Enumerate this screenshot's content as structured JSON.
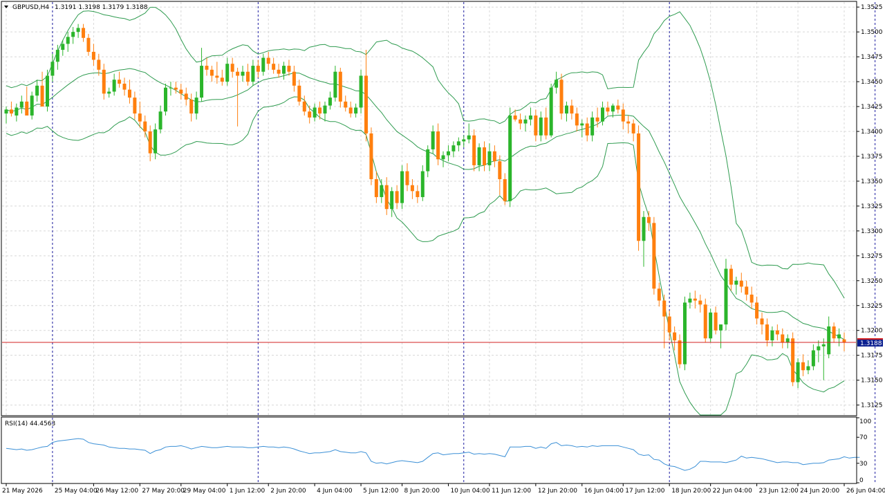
{
  "header": {
    "symbol_label": "GBPUSD,H4",
    "ohlc_label": "1.3191 1.3198 1.3179 1.3188"
  },
  "indicator": {
    "label": "RSI(14) 44.4563"
  },
  "colors": {
    "bull": "#2bb52b",
    "bear": "#ff7f0e",
    "band": "#2e9b4f",
    "rsi": "#3a8fd6",
    "bid_line": "#d32020",
    "bid_box": "#0b1f8f"
  },
  "chart_data": [
    {
      "type": "candlestick",
      "title": "GBPUSD,H4",
      "ylim": [
        1.3115,
        1.353
      ],
      "y_ticks": [
        "1.3525",
        "1.3500",
        "1.3475",
        "1.3450",
        "1.3425",
        "1.3400",
        "1.3375",
        "1.3350",
        "1.3325",
        "1.3300",
        "1.3275",
        "1.3250",
        "1.3225",
        "1.3200",
        "1.3175",
        "1.3150",
        "1.3125"
      ],
      "x_labels": [
        "21 May 2026",
        "25 May 04:00",
        "26 May 12:00",
        "27 May 20:00",
        "29 May 04:00",
        "1 Jun 12:00",
        "2 Jun 20:00",
        "4 Jun 04:00",
        "5 Jun 12:00",
        "8 Jun 20:00",
        "10 Jun 04:00",
        "11 Jun 12:00",
        "12 Jun 20:00",
        "16 Jun 04:00",
        "17 Jun 12:00",
        "18 Jun 20:00",
        "22 Jun 04:00",
        "23 Jun 12:00",
        "24 Jun 20:00",
        "26 Jun 04:00"
      ],
      "current_price": 1.3188,
      "current_price_label": "1.3188",
      "grid": true,
      "candles": [
        [
          1.3418,
          1.3425,
          1.3408,
          1.3422
        ],
        [
          1.3422,
          1.343,
          1.3415,
          1.3418
        ],
        [
          1.3416,
          1.3428,
          1.341,
          1.3424
        ],
        [
          1.3424,
          1.3436,
          1.3418,
          1.343
        ],
        [
          1.343,
          1.3445,
          1.342,
          1.3416
        ],
        [
          1.3416,
          1.344,
          1.3412,
          1.3436
        ],
        [
          1.3436,
          1.3452,
          1.343,
          1.3446
        ],
        [
          1.3446,
          1.346,
          1.3438,
          1.3425
        ],
        [
          1.3425,
          1.3462,
          1.342,
          1.3456
        ],
        [
          1.3456,
          1.3478,
          1.345,
          1.347
        ],
        [
          1.347,
          1.3487,
          1.3462,
          1.3482
        ],
        [
          1.3482,
          1.3492,
          1.3476,
          1.3488
        ],
        [
          1.3488,
          1.35,
          1.348,
          1.3495
        ],
        [
          1.3495,
          1.3505,
          1.3488,
          1.35
        ],
        [
          1.35,
          1.3508,
          1.3494,
          1.3504
        ],
        [
          1.3504,
          1.3508,
          1.349,
          1.3494
        ],
        [
          1.3494,
          1.3498,
          1.3476,
          1.348
        ],
        [
          1.348,
          1.3488,
          1.3466,
          1.3472
        ],
        [
          1.3472,
          1.3478,
          1.3456,
          1.3462
        ],
        [
          1.3462,
          1.3468,
          1.3432,
          1.3438
        ],
        [
          1.3438,
          1.3444,
          1.3434,
          1.344
        ],
        [
          1.344,
          1.3458,
          1.3436,
          1.3452
        ],
        [
          1.3452,
          1.346,
          1.3444,
          1.3448
        ],
        [
          1.3448,
          1.3454,
          1.3436,
          1.3442
        ],
        [
          1.3442,
          1.3452,
          1.3428,
          1.3434
        ],
        [
          1.3434,
          1.344,
          1.3412,
          1.3418
        ],
        [
          1.3418,
          1.343,
          1.3404,
          1.341
        ],
        [
          1.341,
          1.3416,
          1.3394,
          1.34
        ],
        [
          1.34,
          1.3406,
          1.337,
          1.3378
        ],
        [
          1.3378,
          1.3408,
          1.3372,
          1.3402
        ],
        [
          1.3402,
          1.3426,
          1.3398,
          1.342
        ],
        [
          1.342,
          1.3448,
          1.3416,
          1.3444
        ],
        [
          1.3444,
          1.345,
          1.3436,
          1.3444
        ],
        [
          1.3444,
          1.345,
          1.3438,
          1.3442
        ],
        [
          1.3442,
          1.3448,
          1.3432,
          1.3438
        ],
        [
          1.3438,
          1.3444,
          1.3426,
          1.3432
        ],
        [
          1.3432,
          1.3438,
          1.341,
          1.3418
        ],
        [
          1.3418,
          1.344,
          1.3412,
          1.3434
        ],
        [
          1.3434,
          1.3484,
          1.343,
          1.3466
        ],
        [
          1.3466,
          1.3474,
          1.3456,
          1.3462
        ],
        [
          1.3462,
          1.3466,
          1.345,
          1.3456
        ],
        [
          1.3456,
          1.347,
          1.3448,
          1.3454
        ],
        [
          1.3454,
          1.3462,
          1.3446,
          1.345
        ],
        [
          1.345,
          1.3474,
          1.3446,
          1.3468
        ],
        [
          1.3468,
          1.3474,
          1.3454,
          1.346
        ],
        [
          1.346,
          1.3464,
          1.3405,
          1.3456
        ],
        [
          1.3456,
          1.3466,
          1.345,
          1.346
        ],
        [
          1.346,
          1.3468,
          1.3446,
          1.345
        ],
        [
          1.345,
          1.3472,
          1.3446,
          1.3466
        ],
        [
          1.3466,
          1.3472,
          1.3454,
          1.346
        ],
        [
          1.346,
          1.3478,
          1.3456,
          1.3474
        ],
        [
          1.3474,
          1.348,
          1.3462,
          1.3468
        ],
        [
          1.3468,
          1.3474,
          1.3458,
          1.3462
        ],
        [
          1.3462,
          1.3468,
          1.3454,
          1.3458
        ],
        [
          1.3458,
          1.347,
          1.3452,
          1.3466
        ],
        [
          1.3466,
          1.3472,
          1.3456,
          1.346
        ],
        [
          1.346,
          1.3466,
          1.344,
          1.3446
        ],
        [
          1.3446,
          1.3452,
          1.3426,
          1.343
        ],
        [
          1.343,
          1.3436,
          1.3416,
          1.342
        ],
        [
          1.342,
          1.3426,
          1.3408,
          1.3414
        ],
        [
          1.3414,
          1.3428,
          1.341,
          1.3424
        ],
        [
          1.3424,
          1.343,
          1.3412,
          1.3418
        ],
        [
          1.3418,
          1.343,
          1.341,
          1.3426
        ],
        [
          1.3426,
          1.344,
          1.3422,
          1.3434
        ],
        [
          1.3434,
          1.3466,
          1.343,
          1.346
        ],
        [
          1.346,
          1.3464,
          1.3424,
          1.343
        ],
        [
          1.343,
          1.3436,
          1.342,
          1.3424
        ],
        [
          1.3424,
          1.343,
          1.3414,
          1.3418
        ],
        [
          1.3418,
          1.3428,
          1.3414,
          1.3424
        ],
        [
          1.3424,
          1.3462,
          1.3418,
          1.3456
        ],
        [
          1.3456,
          1.3482,
          1.339,
          1.3398
        ],
        [
          1.3398,
          1.3404,
          1.3346,
          1.3352
        ],
        [
          1.3352,
          1.336,
          1.3328,
          1.3334
        ],
        [
          1.3334,
          1.3352,
          1.3328,
          1.3346
        ],
        [
          1.3346,
          1.3354,
          1.3316,
          1.3322
        ],
        [
          1.3322,
          1.3344,
          1.3314,
          1.334
        ],
        [
          1.334,
          1.3346,
          1.3322,
          1.3328
        ],
        [
          1.3328,
          1.3366,
          1.3322,
          1.336
        ],
        [
          1.336,
          1.3368,
          1.334,
          1.3346
        ],
        [
          1.3346,
          1.3352,
          1.3332,
          1.334
        ],
        [
          1.334,
          1.3346,
          1.3328,
          1.3334
        ],
        [
          1.3334,
          1.3366,
          1.333,
          1.336
        ],
        [
          1.336,
          1.3386,
          1.3354,
          1.3382
        ],
        [
          1.3382,
          1.3406,
          1.3378,
          1.34
        ],
        [
          1.34,
          1.3408,
          1.3366,
          1.3372
        ],
        [
          1.3372,
          1.338,
          1.3364,
          1.3376
        ],
        [
          1.3376,
          1.3386,
          1.337,
          1.338
        ],
        [
          1.338,
          1.339,
          1.3374,
          1.3386
        ],
        [
          1.3386,
          1.3394,
          1.338,
          1.339
        ],
        [
          1.339,
          1.3396,
          1.3384,
          1.3392
        ],
        [
          1.3392,
          1.3408,
          1.3388,
          1.3396
        ],
        [
          1.3396,
          1.3402,
          1.336,
          1.3366
        ],
        [
          1.3366,
          1.3388,
          1.336,
          1.3384
        ],
        [
          1.3384,
          1.339,
          1.336,
          1.3366
        ],
        [
          1.3366,
          1.3388,
          1.336,
          1.338
        ],
        [
          1.338,
          1.3386,
          1.3364,
          1.337
        ],
        [
          1.337,
          1.3376,
          1.3336,
          1.3352
        ],
        [
          1.3352,
          1.3358,
          1.3326,
          1.333
        ],
        [
          1.333,
          1.3424,
          1.3324,
          1.3416
        ],
        [
          1.3416,
          1.3422,
          1.341,
          1.3412
        ],
        [
          1.3412,
          1.3418,
          1.3402,
          1.3408
        ],
        [
          1.3408,
          1.3416,
          1.34,
          1.3412
        ],
        [
          1.3412,
          1.3424,
          1.3406,
          1.3416
        ],
        [
          1.3416,
          1.3422,
          1.339,
          1.3396
        ],
        [
          1.3396,
          1.342,
          1.339,
          1.3414
        ],
        [
          1.3414,
          1.3424,
          1.3392,
          1.3396
        ],
        [
          1.3396,
          1.3448,
          1.3394,
          1.3444
        ],
        [
          1.3444,
          1.346,
          1.3438,
          1.3452
        ],
        [
          1.3452,
          1.3458,
          1.3412,
          1.3418
        ],
        [
          1.3418,
          1.343,
          1.341,
          1.3426
        ],
        [
          1.3426,
          1.3432,
          1.3412,
          1.3418
        ],
        [
          1.3418,
          1.3424,
          1.34,
          1.3406
        ],
        [
          1.3406,
          1.3412,
          1.3394,
          1.3408
        ],
        [
          1.3408,
          1.3414,
          1.339,
          1.3396
        ],
        [
          1.3396,
          1.342,
          1.339,
          1.3414
        ],
        [
          1.3414,
          1.3424,
          1.3404,
          1.341
        ],
        [
          1.341,
          1.343,
          1.3406,
          1.3424
        ],
        [
          1.3424,
          1.343,
          1.3416,
          1.342
        ],
        [
          1.342,
          1.3428,
          1.3414,
          1.3426
        ],
        [
          1.3426,
          1.3432,
          1.3418,
          1.3422
        ],
        [
          1.3422,
          1.3428,
          1.3402,
          1.341
        ],
        [
          1.341,
          1.3416,
          1.3398,
          1.3408
        ],
        [
          1.3408,
          1.3412,
          1.339,
          1.3398
        ],
        [
          1.3398,
          1.3406,
          1.328,
          1.329
        ],
        [
          1.329,
          1.332,
          1.3264,
          1.3314
        ],
        [
          1.3314,
          1.332,
          1.33,
          1.3308
        ],
        [
          1.3308,
          1.3314,
          1.3236,
          1.3242
        ],
        [
          1.3242,
          1.3248,
          1.3224,
          1.323
        ],
        [
          1.323,
          1.3236,
          1.3182,
          1.3214
        ],
        [
          1.3214,
          1.322,
          1.319,
          1.3198
        ],
        [
          1.3198,
          1.3204,
          1.318,
          1.319
        ],
        [
          1.319,
          1.3196,
          1.3162,
          1.3166
        ],
        [
          1.3166,
          1.3234,
          1.316,
          1.3228
        ],
        [
          1.3228,
          1.3238,
          1.3222,
          1.3232
        ],
        [
          1.3232,
          1.324,
          1.3222,
          1.323
        ],
        [
          1.323,
          1.3236,
          1.3218,
          1.3226
        ],
        [
          1.3226,
          1.3232,
          1.3188,
          1.3192
        ],
        [
          1.3192,
          1.3222,
          1.3188,
          1.3218
        ],
        [
          1.3218,
          1.3224,
          1.3196,
          1.32
        ],
        [
          1.32,
          1.3206,
          1.3182,
          1.3206
        ],
        [
          1.3206,
          1.3272,
          1.32,
          1.3262
        ],
        [
          1.3262,
          1.3266,
          1.324,
          1.3246
        ],
        [
          1.3246,
          1.3254,
          1.3236,
          1.325
        ],
        [
          1.325,
          1.3258,
          1.3238,
          1.3244
        ],
        [
          1.3244,
          1.325,
          1.323,
          1.3236
        ],
        [
          1.3236,
          1.3244,
          1.3222,
          1.3228
        ],
        [
          1.3228,
          1.3234,
          1.3206,
          1.3212
        ],
        [
          1.3212,
          1.3218,
          1.3196,
          1.3206
        ],
        [
          1.3206,
          1.3212,
          1.3184,
          1.319
        ],
        [
          1.319,
          1.3204,
          1.3184,
          1.32
        ],
        [
          1.32,
          1.3206,
          1.319,
          1.3196
        ],
        [
          1.3196,
          1.3202,
          1.3182,
          1.3188
        ],
        [
          1.3188,
          1.3196,
          1.3182,
          1.3192
        ],
        [
          1.3192,
          1.3198,
          1.3144,
          1.3148
        ],
        [
          1.3148,
          1.3172,
          1.3142,
          1.3168
        ],
        [
          1.3168,
          1.3176,
          1.3154,
          1.316
        ],
        [
          1.316,
          1.317,
          1.3156,
          1.3164
        ],
        [
          1.3164,
          1.3186,
          1.316,
          1.318
        ],
        [
          1.318,
          1.319,
          1.3168,
          1.3184
        ],
        [
          1.3184,
          1.3192,
          1.315,
          1.3186
        ],
        [
          1.3176,
          1.3214,
          1.3172,
          1.3204
        ],
        [
          1.3204,
          1.3208,
          1.3188,
          1.3192
        ],
        [
          1.3192,
          1.3202,
          1.3184,
          1.3196
        ],
        [
          1.3191,
          1.3198,
          1.3179,
          1.3188
        ]
      ]
    },
    {
      "type": "line",
      "title": "RSI(14) 44.4563",
      "ylim": [
        0,
        100
      ],
      "y_ticks": [
        "100",
        "70",
        "30",
        "0"
      ],
      "series": [
        {
          "values": [
            53,
            52,
            51,
            52,
            50,
            51,
            53,
            55,
            56,
            62,
            64,
            65,
            66,
            67,
            68,
            67,
            62,
            60,
            59,
            58,
            55,
            54,
            53,
            53,
            52,
            52,
            51,
            50,
            45,
            49,
            51,
            55,
            56,
            56,
            57,
            55,
            52,
            54,
            56,
            55,
            54,
            54,
            55,
            56,
            55,
            55,
            55,
            54,
            54,
            55,
            56,
            55,
            55,
            54,
            55,
            54,
            52,
            49,
            47,
            45,
            46,
            46,
            47,
            48,
            51,
            48,
            47,
            46,
            46,
            48,
            46,
            33,
            30,
            31,
            29,
            31,
            33,
            34,
            33,
            32,
            31,
            33,
            39,
            45,
            46,
            43,
            44,
            45,
            45,
            46,
            47,
            44,
            45,
            44,
            45,
            44,
            42,
            40,
            55,
            55,
            55,
            56,
            56,
            53,
            55,
            53,
            60,
            62,
            57,
            58,
            57,
            55,
            56,
            55,
            57,
            56,
            57,
            57,
            57,
            57,
            55,
            53,
            51,
            44,
            42,
            43,
            36,
            35,
            29,
            26,
            25,
            22,
            19,
            21,
            25,
            33,
            33,
            32,
            32,
            32,
            31,
            33,
            35,
            41,
            38,
            39,
            38,
            37,
            35,
            33,
            31,
            32,
            32,
            31,
            31,
            28,
            29,
            30,
            30,
            31,
            35,
            36,
            37,
            40,
            38,
            39,
            39
          ]
        }
      ]
    }
  ]
}
